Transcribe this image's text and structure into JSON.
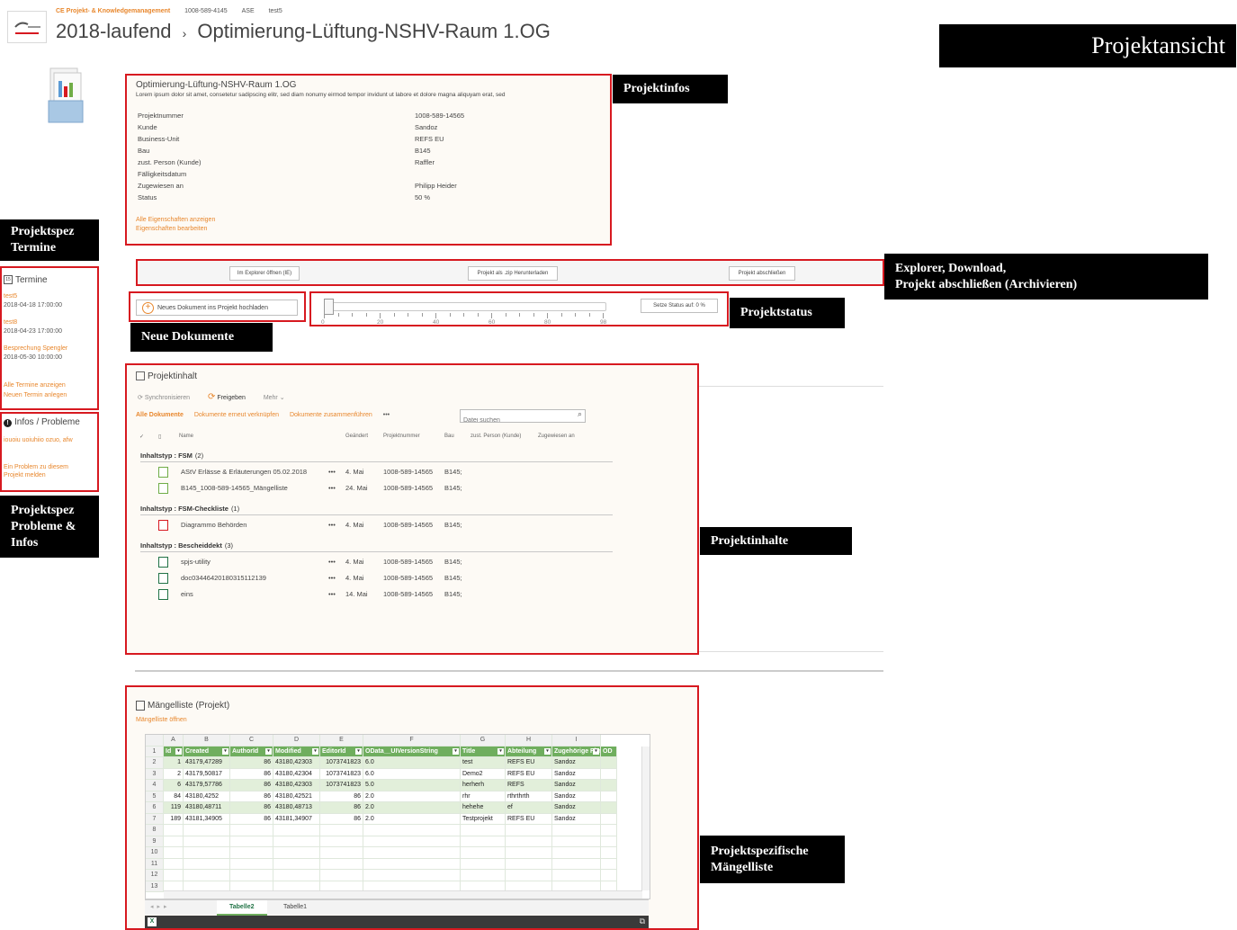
{
  "header": {
    "site_links": [
      "CE Projekt- & Knowledgemanagement",
      "1008-589-4145",
      "ASE",
      "test5"
    ],
    "breadcrumb_parent": "2018-laufend",
    "breadcrumb_sep": "›",
    "breadcrumb_current": "Optimierung-Lüftung-NSHV-Raum 1.OG",
    "page_badge": "Projektansicht"
  },
  "project_info": {
    "title": "Optimierung-Lüftung-NSHV-Raum 1.OG",
    "description": "Lorem ipsum dolor sit amet, consetetur sadipscing elitr, sed diam nonumy eirmod tempor invidunt ut labore et dolore magna aliquyam erat, sed",
    "properties": [
      {
        "label": "Projektnummer",
        "value": "1008-589-14565"
      },
      {
        "label": "Kunde",
        "value": "Sandoz"
      },
      {
        "label": "Business-Unit",
        "value": "REFS EU"
      },
      {
        "label": "Bau",
        "value": "B145"
      },
      {
        "label": "zust. Person (Kunde)",
        "value": "Raffler"
      },
      {
        "label": "Fälligkeitsdatum",
        "value": ""
      },
      {
        "label": "Zugewiesen an",
        "value": "Philipp Heider"
      },
      {
        "label": "Status",
        "value": "50 %"
      }
    ],
    "link_all_props": "Alle Eigenschaften anzeigen",
    "link_edit_props": "Eigenschaften bearbeiten"
  },
  "actions": {
    "explorer": "Im Explorer öffnen (IE)",
    "download_zip": "Projekt als .zip Herunterladen",
    "close_project": "Projekt abschließen",
    "upload": "Neues Dokument ins Projekt hochladen",
    "status_button": "Setze Status auf: 0  %",
    "slider_value": 0,
    "slider_labels": [
      "0",
      "20",
      "40",
      "60",
      "80",
      "98"
    ]
  },
  "termine": {
    "heading": "Termine",
    "items": [
      {
        "title": "test5",
        "date": "2018-04-18 17:00:00"
      },
      {
        "title": "test8",
        "date": "2018-04-23 17:00:00"
      },
      {
        "title": "Besprechung Spengler",
        "date": "2018-05-30 10:00:00"
      }
    ],
    "link_all": "Alle Termine anzeigen",
    "link_new": "Neuen Termin anlegen"
  },
  "infos": {
    "heading": "Infos / Probleme",
    "item": "iouoiu uoiuhiio ozuo, afw",
    "report_line1": "Ein Problem zu diesem",
    "report_line2": "Projekt melden"
  },
  "projektinhalt": {
    "heading": "Projektinhalt",
    "toolbar": {
      "sync": "Synchronisieren",
      "share": "Freigeben",
      "more": "Mehr"
    },
    "views": {
      "all": "Alle Dokumente",
      "relink": "Dokumente erneut verknüpfen",
      "merge": "Dokumente zusammenführen",
      "ellipsis": "•••"
    },
    "search_placeholder": "Datei suchen",
    "columns": {
      "name": "Name",
      "changed": "Geändert",
      "projnr": "Projektnummer",
      "bau": "Bau",
      "person": "zust. Person (Kunde)",
      "assigned": "Zugewiesen an"
    },
    "groups": [
      {
        "label": "Inhaltstyp : FSM",
        "count": "(2)",
        "rows": [
          {
            "name": "AStV Erlässe & Erläuterungen 05.02.2018",
            "changed": "4. Mai",
            "projnr": "1008-589-14565",
            "bau": "B145;"
          },
          {
            "name": "B145_1008-589-14565_Mängelliste",
            "changed": "24. Mai",
            "projnr": "1008-589-14565",
            "bau": "B145;"
          }
        ]
      },
      {
        "label": "Inhaltstyp : FSM-Checkliste",
        "count": "(1)",
        "rows": [
          {
            "name": "Diagrammo Behörden",
            "changed": "4. Mai",
            "projnr": "1008-589-14565",
            "bau": "B145;"
          }
        ]
      },
      {
        "label": "Inhaltstyp : Bescheiddekt",
        "count": "(3)",
        "rows": [
          {
            "name": "spjs-utility",
            "changed": "4. Mai",
            "projnr": "1008-589-14565",
            "bau": "B145;"
          },
          {
            "name": "doc03446420180315112139",
            "changed": "4. Mai",
            "projnr": "1008-589-14565",
            "bau": "B145;"
          },
          {
            "name": "eins",
            "changed": "14. Mai",
            "projnr": "1008-589-14565",
            "bau": "B145;"
          }
        ]
      }
    ]
  },
  "maengelliste": {
    "heading": "Mängelliste (Projekt)",
    "open_link": "Mängelliste öffnen",
    "col_letters": [
      "A",
      "B",
      "C",
      "D",
      "E",
      "F",
      "G",
      "H",
      "I"
    ],
    "col_headers": [
      "Id",
      "Created",
      "AuthorId",
      "Modified",
      "EditorId",
      "OData__UIVersionString",
      "Title",
      "Abteilung",
      "Zugehörige Firma",
      "OD"
    ],
    "rows": [
      [
        "1",
        "43179,47289",
        "86",
        "43180,42303",
        "1073741823",
        "6.0",
        "test",
        "REFS EU",
        "Sandoz"
      ],
      [
        "2",
        "43179,50817",
        "86",
        "43180,42304",
        "1073741823",
        "6.0",
        "Demo2",
        "REFS EU",
        "Sandoz"
      ],
      [
        "6",
        "43179,57786",
        "86",
        "43180,42303",
        "1073741823",
        "5.0",
        "herherh",
        "REFS",
        "Sandoz"
      ],
      [
        "84",
        "43180,4252",
        "86",
        "43180,42521",
        "86",
        "2.0",
        "rhr",
        "rthrthrth",
        "Sandoz"
      ],
      [
        "119",
        "43180,48711",
        "86",
        "43180,48713",
        "86",
        "2.0",
        "hehehe",
        "ef",
        "Sandoz"
      ],
      [
        "189",
        "43181,34905",
        "86",
        "43181,34907",
        "86",
        "2.0",
        "Testprojekt",
        "REFS EU",
        "Sandoz"
      ]
    ],
    "row_numbers": [
      "1",
      "2",
      "3",
      "4",
      "5",
      "6",
      "7",
      "8",
      "9",
      "10",
      "11",
      "12",
      "13"
    ],
    "sheet_tabs": [
      "Tabelle2",
      "Tabelle1"
    ]
  },
  "callouts": {
    "projektinfos": "Projektinfos",
    "explorer_line1": "Explorer, Download,",
    "explorer_line2": "Projekt abschließen (Archivieren)",
    "projektstatus": "Projektstatus",
    "neue_dokumente": "Neue Dokumente",
    "termine_line1": "Projektspez",
    "termine_line2": "Termine",
    "probleme_line1": "Projektspez",
    "probleme_line2": "Probleme &",
    "probleme_line3": "Infos",
    "projektinhalte": "Projektinhalte",
    "maengel_line1": "Projektspezifische",
    "maengel_line2": "Mängelliste"
  },
  "colors": {
    "accent_red": "#d71920",
    "link_orange": "#e8872d",
    "excel_green": "#6fae5e",
    "excel_dark": "#3a3a3a"
  }
}
